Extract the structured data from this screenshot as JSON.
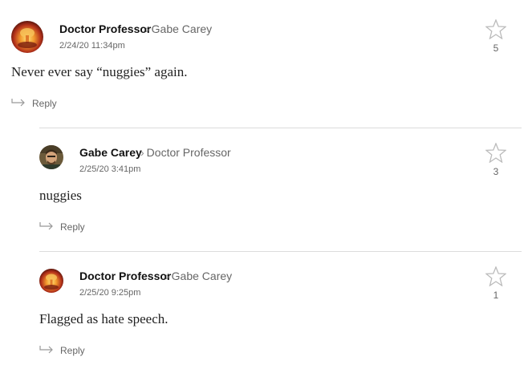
{
  "comments": [
    {
      "author": "Doctor Professor",
      "reply_to": "Gabe Carey",
      "timestamp": "2/24/20 11:34pm",
      "text": "Never ever say “nuggies” again.",
      "likes": "5",
      "reply_label": "Reply",
      "avatar": "explosion-avatar"
    },
    {
      "author": "Gabe Carey",
      "reply_to": "Doctor Professor",
      "timestamp": "2/25/20 3:41pm",
      "text": "nuggies",
      "likes": "3",
      "reply_label": "Reply",
      "avatar": "person-photo-avatar"
    },
    {
      "author": "Doctor Professor",
      "reply_to": "Gabe Carey",
      "timestamp": "2/25/20 9:25pm",
      "text": "Flagged as hate speech.",
      "likes": "1",
      "reply_label": "Reply",
      "avatar": "explosion-avatar"
    }
  ],
  "colors": {
    "text": "#222222",
    "muted": "#666666",
    "divider": "#dcdcdc",
    "star_outline": "#bbbbbb"
  }
}
